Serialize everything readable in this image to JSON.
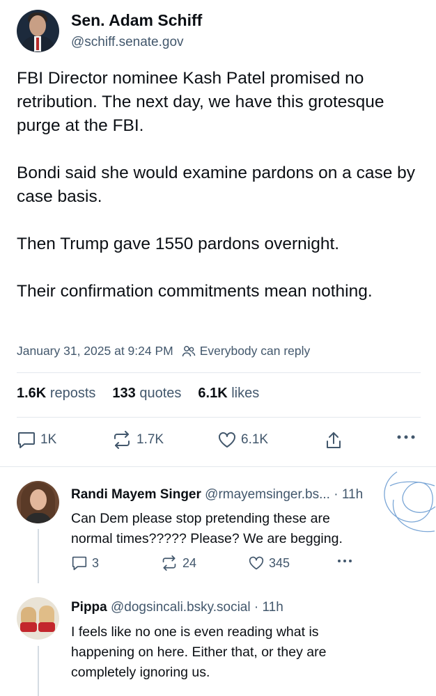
{
  "post": {
    "author_name": "Sen. Adam Schiff",
    "author_handle": "@schiff.senate.gov",
    "paragraphs": [
      "FBI Director nominee Kash Patel promised no retribution. The next day, we have this grotesque purge at the FBI.",
      "Bondi said she would examine pardons on a case by case basis.",
      "Then Trump gave 1550 pardons overnight.",
      "Their confirmation commitments mean nothing."
    ],
    "timestamp": "January 31, 2025 at 9:24 PM",
    "reply_setting": "Everybody can reply",
    "stats": {
      "reposts_count": "1.6K",
      "reposts_label": "reposts",
      "quotes_count": "133",
      "quotes_label": "quotes",
      "likes_count": "6.1K",
      "likes_label": "likes"
    },
    "actions": {
      "reply_count": "1K",
      "repost_count": "1.7K",
      "like_count": "6.1K"
    }
  },
  "replies": [
    {
      "name": "Randi Mayem Singer",
      "handle": "@rmayemsinger.bs...",
      "time": "· 11h",
      "lines": [
        "Can Dem please stop pretending these are",
        "normal times????? Please? We are begging."
      ],
      "reply_count": "3",
      "repost_count": "24",
      "like_count": "345"
    },
    {
      "name": "Pippa",
      "handle": "@dogsincali.bsky.social · 11h",
      "lines": [
        "I feels like no one is even reading what is",
        "happening on here. Either that, or they are",
        "completely ignoring us."
      ]
    }
  ],
  "colors": {
    "text": "#0b0f14",
    "muted": "#42576c",
    "divider": "#e3e8ed",
    "scribble": "#7aa6d6"
  }
}
